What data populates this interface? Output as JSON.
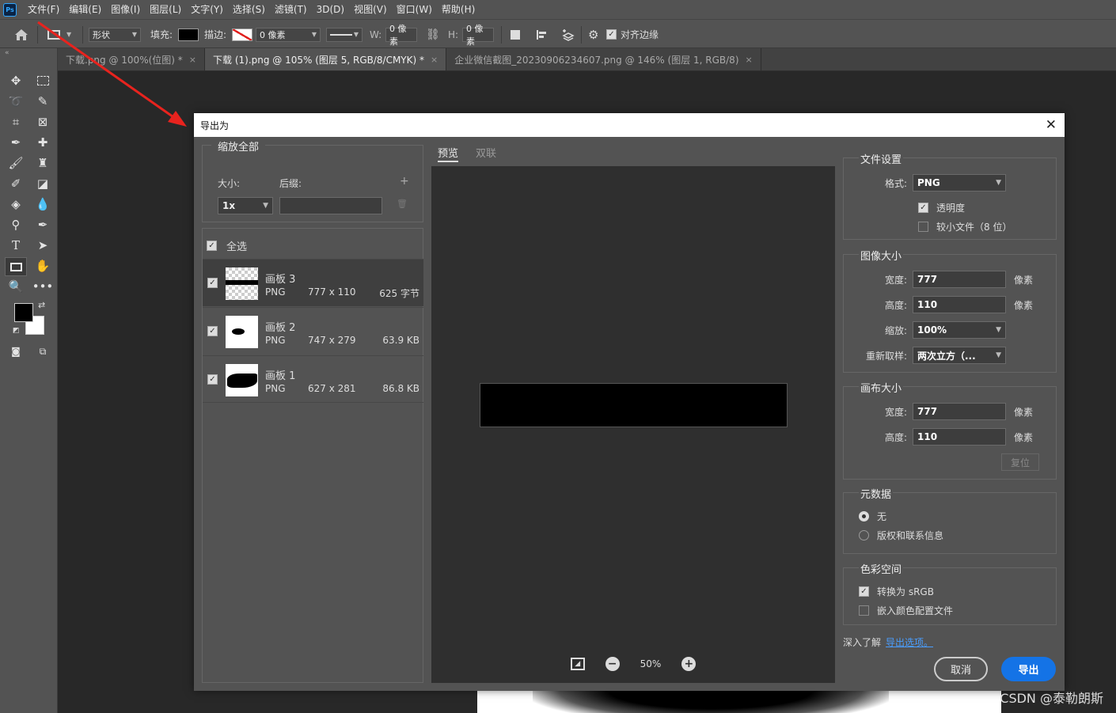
{
  "menu": {
    "logo": "Ps",
    "items": [
      "文件(F)",
      "编辑(E)",
      "图像(I)",
      "图层(L)",
      "文字(Y)",
      "选择(S)",
      "滤镜(T)",
      "3D(D)",
      "视图(V)",
      "窗口(W)",
      "帮助(H)"
    ]
  },
  "options": {
    "shape_mode": "形状",
    "fill_label": "填充:",
    "stroke_label": "描边:",
    "stroke_width": "0 像素",
    "w_label": "W:",
    "w_value": "0 像素",
    "h_label": "H:",
    "h_value": "0 像素",
    "align_edges": "对齐边缘"
  },
  "tabs": [
    {
      "title": "下载.png @ 100%(位图) *",
      "close": "×"
    },
    {
      "title": "下载 (1).png @ 105% (图层 5, RGB/8/CMYK) *",
      "close": "×"
    },
    {
      "title": "企业微信截图_20230906234607.png @ 146% (图层 1, RGB/8)",
      "close": "×"
    }
  ],
  "dialog": {
    "title": "导出为",
    "close": "✕",
    "left": {
      "scale_header": "缩放全部",
      "size_label": "大小:",
      "suffix_label": "后缀:",
      "size_value": "1x",
      "suffix_value": "",
      "add": "+",
      "trash": "🗑",
      "select_all": "全选",
      "assets": [
        {
          "name": "画板 3",
          "format": "PNG",
          "dims": "777 x 110",
          "size": "625 字节"
        },
        {
          "name": "画板 2",
          "format": "PNG",
          "dims": "747 x 279",
          "size": "63.9 KB"
        },
        {
          "name": "画板 1",
          "format": "PNG",
          "dims": "627 x 281",
          "size": "86.8 KB"
        }
      ]
    },
    "preview": {
      "tab_preview": "预览",
      "tab_2up": "双联",
      "zoom": "50%",
      "minus": "−",
      "plus": "+"
    },
    "right": {
      "file_settings": "文件设置",
      "format_label": "格式:",
      "format_value": "PNG",
      "transparency": "透明度",
      "smaller_file": "较小文件（8 位）",
      "image_size": "图像大小",
      "width_label": "宽度:",
      "width_value": "777",
      "height_label": "高度:",
      "height_value": "110",
      "scale_label": "缩放:",
      "scale_value": "100%",
      "resample_label": "重新取样:",
      "resample_value": "两次立方（...",
      "unit": "像素",
      "canvas_size": "画布大小",
      "canvas_width_value": "777",
      "canvas_height_value": "110",
      "reset": "复位",
      "metadata": "元数据",
      "meta_none": "无",
      "meta_copyright": "版权和联系信息",
      "color_space": "色彩空间",
      "convert_srgb": "转换为 sRGB",
      "embed_profile": "嵌入颜色配置文件",
      "learn_more": "深入了解",
      "export_options_link": "导出选项。",
      "cancel": "取消",
      "export": "导出"
    }
  },
  "watermark": "CSDN @泰勒朗斯",
  "colors": {
    "accent": "#1473e6",
    "link": "#4a9eff",
    "arrow": "#e8231e"
  }
}
